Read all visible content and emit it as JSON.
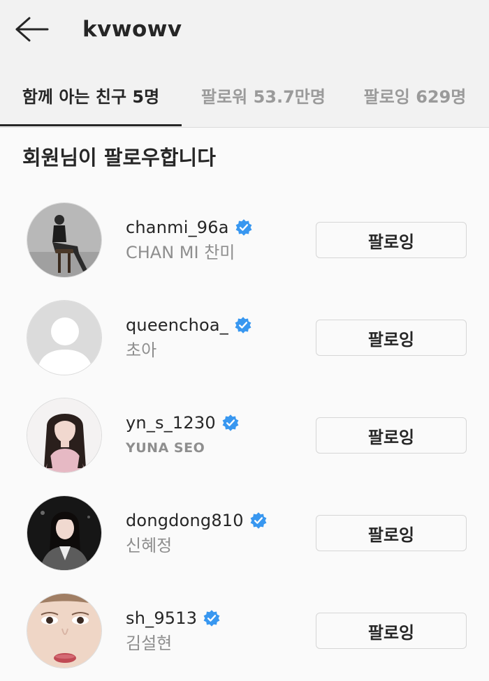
{
  "header": {
    "title": "kvwowv",
    "back_icon": "back-arrow-icon"
  },
  "tabs": [
    {
      "label": "함께 아는 친구 5명",
      "active": true
    },
    {
      "label": "팔로워 53.7만명",
      "active": false
    },
    {
      "label": "팔로잉 629명",
      "active": false
    }
  ],
  "section": {
    "title": "회원님이 팔로우합니다"
  },
  "colors": {
    "verified": "#3897f0",
    "text_primary": "#262626",
    "text_secondary": "#8e8e8e",
    "background": "#fafafa"
  },
  "users": [
    {
      "username": "chanmi_96a",
      "full_name": "CHAN MI 찬미",
      "verified": true,
      "button_label": "팔로잉",
      "avatar": "photo-woman-chair-bw"
    },
    {
      "username": "queenchoa_",
      "full_name": "초아",
      "verified": true,
      "button_label": "팔로잉",
      "avatar": "default-avatar-icon"
    },
    {
      "username": "yn_s_1230",
      "full_name": "YUNA SEO",
      "verified": true,
      "button_label": "팔로잉",
      "avatar": "photo-woman-long-hair"
    },
    {
      "username": "dongdong810",
      "full_name": "신혜정",
      "verified": true,
      "button_label": "팔로잉",
      "avatar": "photo-woman-dark-bg"
    },
    {
      "username": "sh_9513",
      "full_name": "김설현",
      "verified": true,
      "button_label": "팔로잉",
      "avatar": "photo-face-closeup"
    }
  ]
}
